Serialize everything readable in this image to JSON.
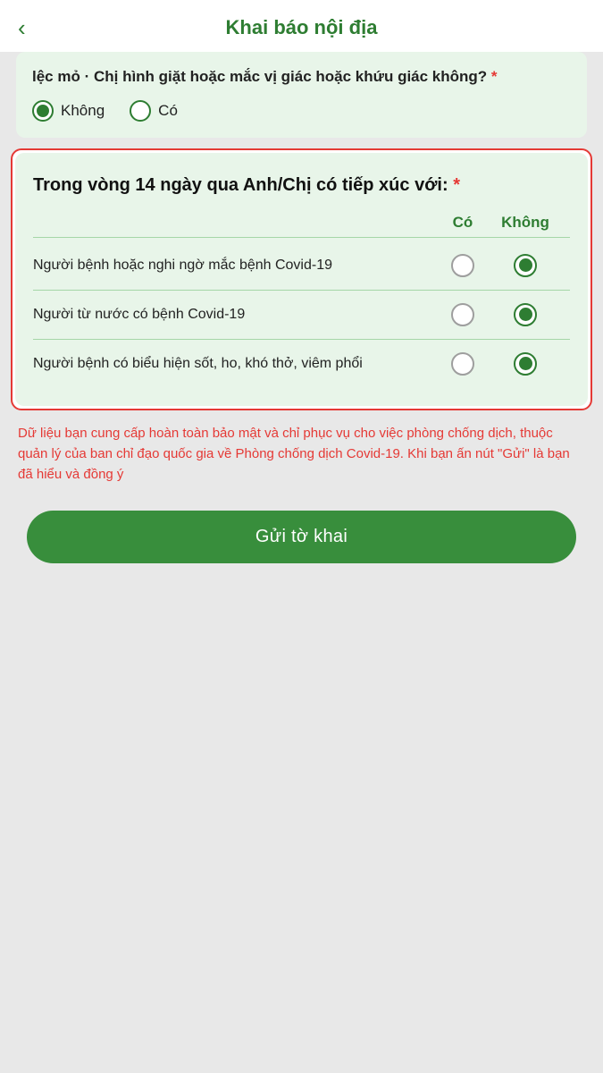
{
  "header": {
    "back_icon": "‹",
    "title": "Khai báo nội địa"
  },
  "prev_card": {
    "question": "lệc mỏ · Chị hình giặt hoặc mắc vị giác hoặc khứu giác không?",
    "required_marker": "*",
    "options": [
      {
        "label": "Không",
        "selected": true
      },
      {
        "label": "Có",
        "selected": false
      }
    ]
  },
  "main_card": {
    "question": "Trong vòng 14 ngày qua Anh/Chị có tiếp xúc với:",
    "required_marker": "*",
    "col_co": "Có",
    "col_khong": "Không",
    "rows": [
      {
        "label": "Người bệnh hoặc nghi ngờ mắc bệnh Covid-19",
        "co_selected": false,
        "khong_selected": true
      },
      {
        "label": "Người từ nước có bệnh Covid-19",
        "co_selected": false,
        "khong_selected": true
      },
      {
        "label": "Người bệnh có biểu hiện sốt, ho, khó thở, viêm phổi",
        "co_selected": false,
        "khong_selected": true
      }
    ]
  },
  "privacy": {
    "text": "Dữ liệu bạn cung cấp hoàn toàn bảo mật và chỉ phục vụ cho việc phòng chống dịch, thuộc quản lý của ban chỉ đạo quốc gia về Phòng chống dịch Covid-19. Khi bạn ấn nút \"Gửi\" là bạn đã hiểu và đồng ý"
  },
  "submit": {
    "label": "Gửi tờ khai"
  }
}
